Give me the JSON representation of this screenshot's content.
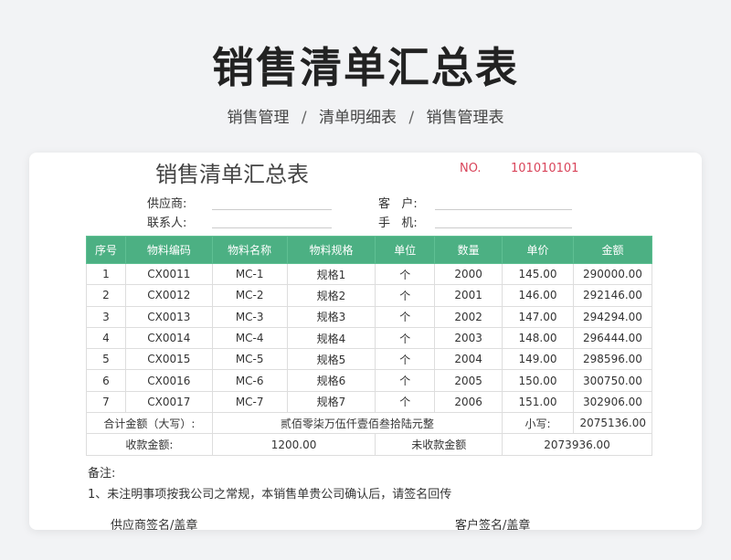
{
  "header": {
    "title": "销售清单汇总表",
    "breadcrumb": [
      "销售管理",
      "清单明细表",
      "销售管理表"
    ],
    "separator": "/"
  },
  "doc": {
    "title": "销售清单汇总表",
    "no_label": "NO.",
    "no_value": "101010101",
    "supplier_label": "供应商:",
    "contact_label": "联系人:",
    "customer_label": "客   户:",
    "phone_label": "手   机:"
  },
  "table": {
    "headers": [
      "序号",
      "物料编码",
      "物料名称",
      "物料规格",
      "单位",
      "数量",
      "单价",
      "金额"
    ],
    "rows": [
      [
        "1",
        "CX0011",
        "MC-1",
        "规格1",
        "个",
        "2000",
        "145.00",
        "290000.00"
      ],
      [
        "2",
        "CX0012",
        "MC-2",
        "规格2",
        "个",
        "2001",
        "146.00",
        "292146.00"
      ],
      [
        "3",
        "CX0013",
        "MC-3",
        "规格3",
        "个",
        "2002",
        "147.00",
        "294294.00"
      ],
      [
        "4",
        "CX0014",
        "MC-4",
        "规格4",
        "个",
        "2003",
        "148.00",
        "296444.00"
      ],
      [
        "5",
        "CX0015",
        "MC-5",
        "规格5",
        "个",
        "2004",
        "149.00",
        "298596.00"
      ],
      [
        "6",
        "CX0016",
        "MC-6",
        "规格6",
        "个",
        "2005",
        "150.00",
        "300750.00"
      ],
      [
        "7",
        "CX0017",
        "MC-7",
        "规格7",
        "个",
        "2006",
        "151.00",
        "302906.00"
      ]
    ],
    "total_label": "合计金额（大写）:",
    "total_words": "贰佰零柒万伍仟壹佰叁拾陆元整",
    "small_label": "小写:",
    "small_value": "2075136.00",
    "received_label": "收款金额:",
    "received_value": "1200.00",
    "unreceived_label": "未收款金额",
    "unreceived_value": "2073936.00"
  },
  "footer": {
    "remarks_label": "备注:",
    "remarks_text": "1、未注明事项按我公司之常规，本销售单贵公司确认后，请签名回传",
    "supplier_sign": "供应商签名/盖章",
    "customer_sign": "客户签名/盖章"
  }
}
